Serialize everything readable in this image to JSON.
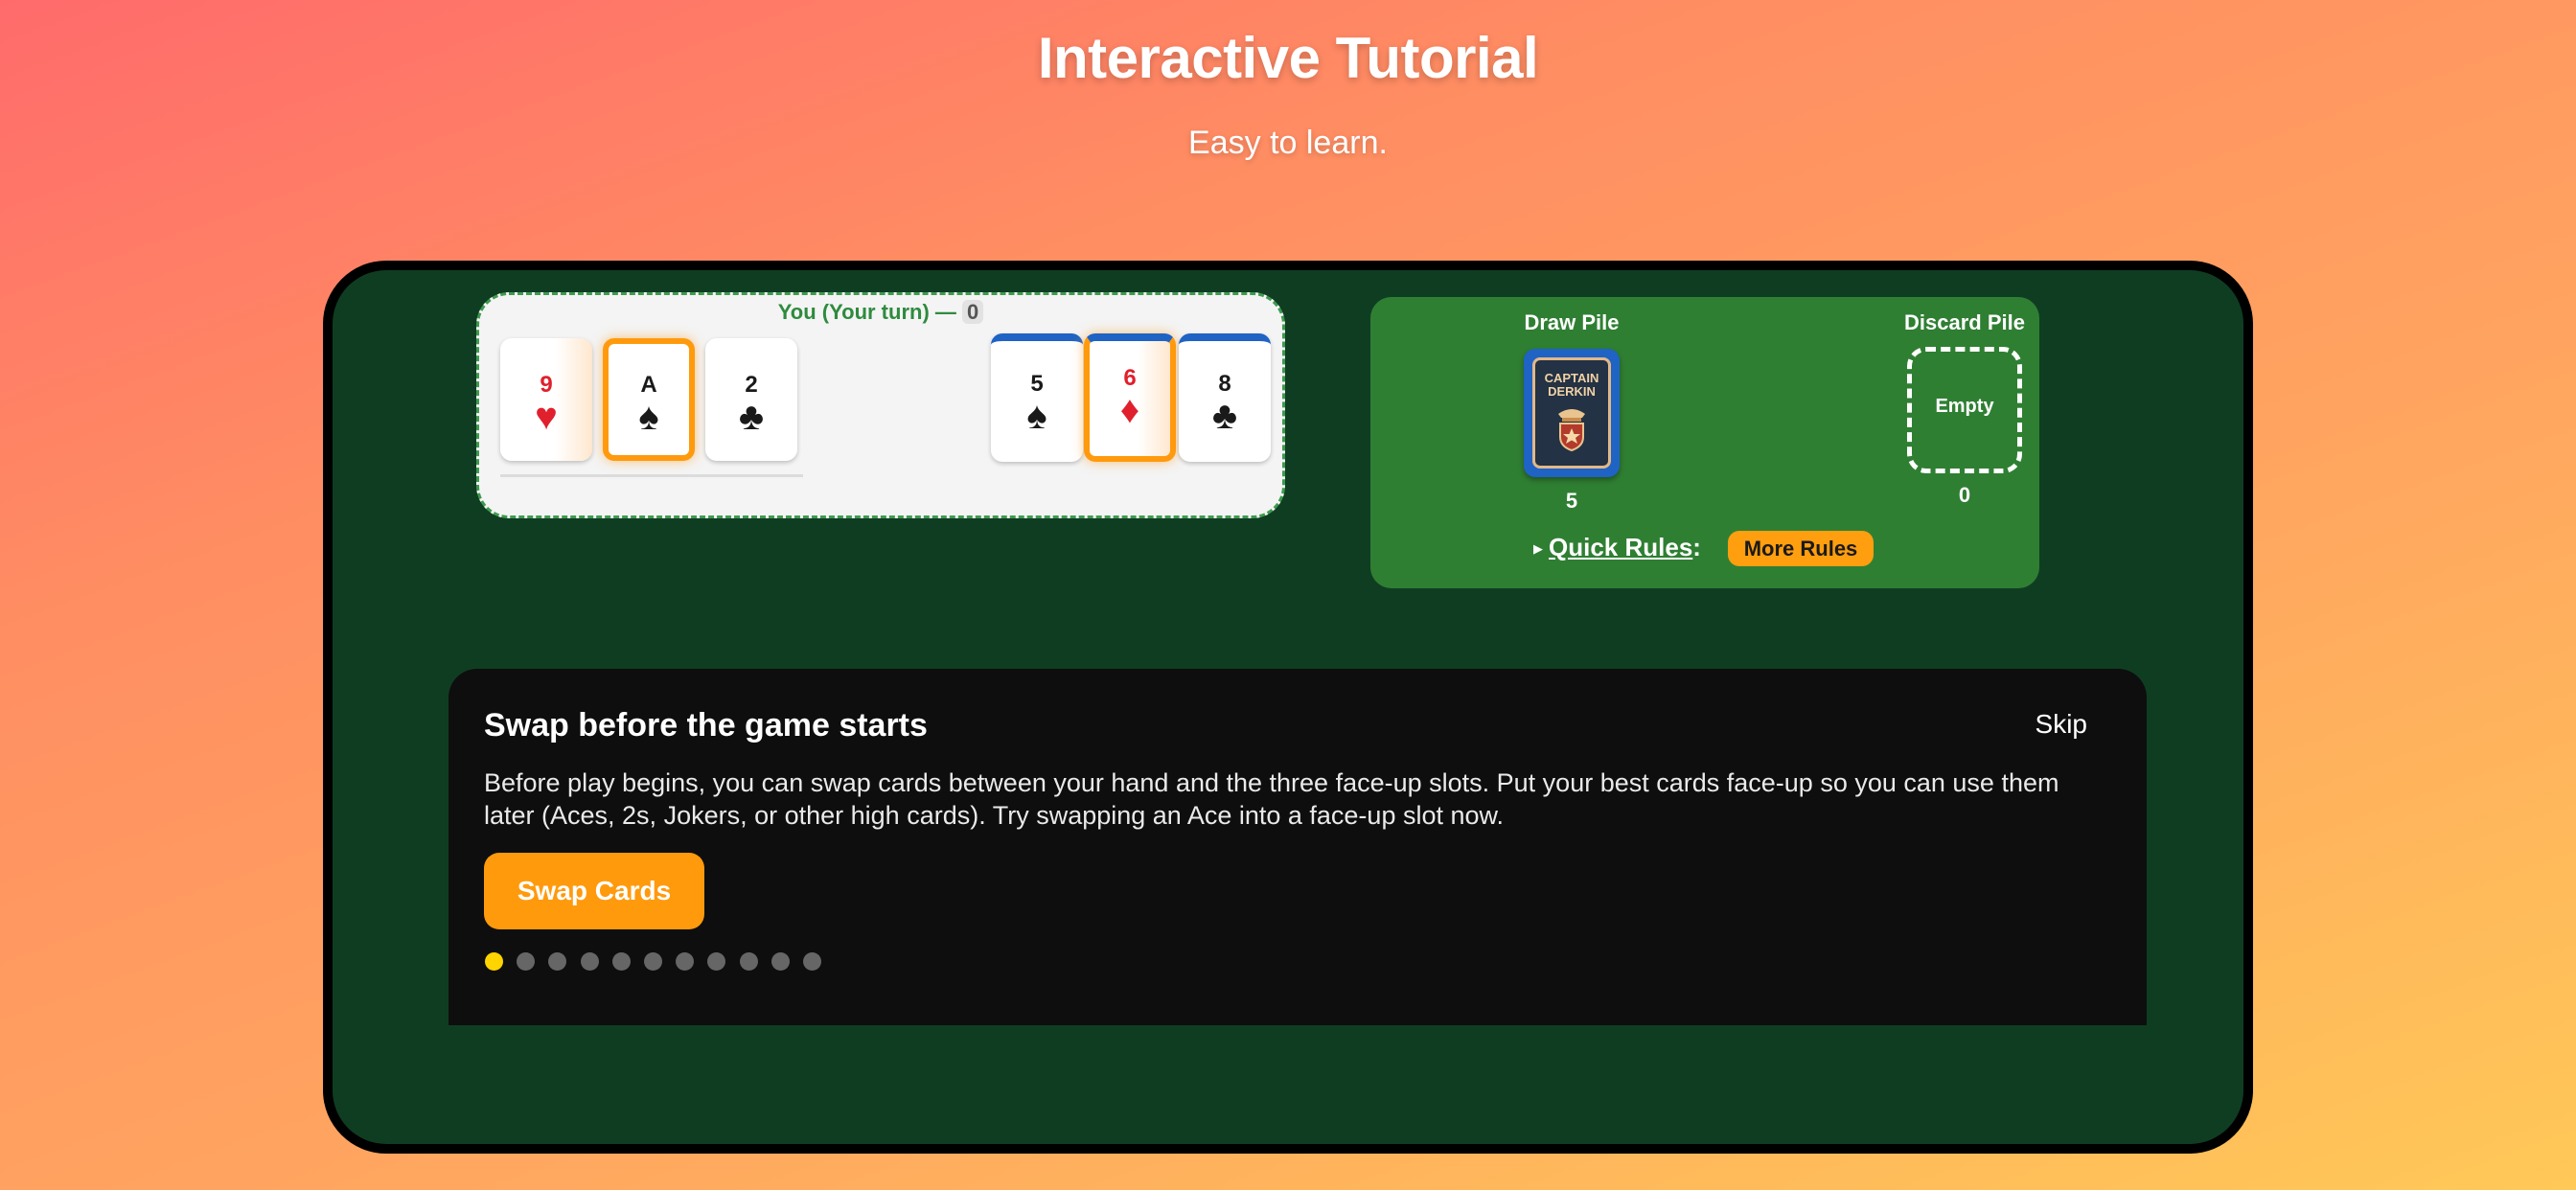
{
  "header": {
    "title": "Interactive Tutorial",
    "subtitle": "Easy to learn."
  },
  "player": {
    "label": "You (Your turn) — ",
    "score": "0",
    "hand": [
      {
        "rank": "9",
        "suit": "♥",
        "color": "red"
      },
      {
        "rank": "A",
        "suit": "♠",
        "color": "black",
        "selected": true
      },
      {
        "rank": "2",
        "suit": "♣",
        "color": "black"
      }
    ],
    "face_up": [
      {
        "rank": "5",
        "suit": "♠",
        "color": "black"
      },
      {
        "rank": "6",
        "suit": "♦",
        "color": "red",
        "selected": true
      },
      {
        "rank": "8",
        "suit": "♣",
        "color": "black"
      }
    ]
  },
  "piles": {
    "draw_label": "Draw Pile",
    "draw_count": "5",
    "draw_card_brand_line1": "CAPTAIN",
    "draw_card_brand_line2": "DERKIN",
    "discard_label": "Discard Pile",
    "discard_empty": "Empty",
    "discard_count": "0",
    "quick_rules_label": "Quick Rules",
    "quick_rules_colon": ":",
    "more_rules_button": "More Rules"
  },
  "tutorial": {
    "title": "Swap before the game starts",
    "skip": "Skip",
    "body": "Before play begins, you can swap cards between your hand and the three face-up slots. Put your best cards face-up so you can use them later (Aces, 2s, Jokers, or other high cards). Try swapping an Ace into a face-up slot now.",
    "button": "Swap Cards",
    "step_total": 11,
    "step_current": 1
  },
  "colors": {
    "accent": "#ff9a0d",
    "table_green": "#0f3d22",
    "pile_green": "#2f7f33",
    "active_dot": "#ffd400"
  }
}
